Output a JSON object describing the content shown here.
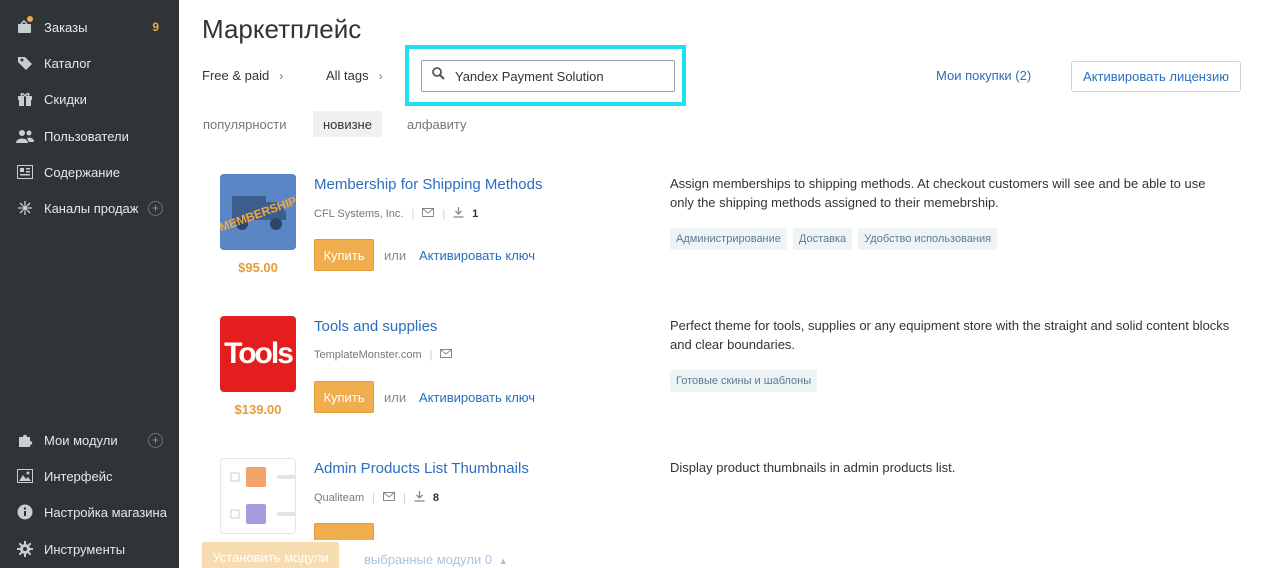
{
  "sidebar": {
    "items": [
      {
        "label": "Заказы",
        "badge": "9",
        "icon": "orders-icon"
      },
      {
        "label": "Каталог",
        "icon": "tag-icon"
      },
      {
        "label": "Скидки",
        "icon": "gift-icon"
      },
      {
        "label": "Пользователи",
        "icon": "users-icon"
      },
      {
        "label": "Содержание",
        "icon": "content-icon"
      },
      {
        "label": "Каналы продаж",
        "icon": "channels-icon"
      },
      {
        "label": "Мои модули",
        "icon": "puzzle-icon"
      },
      {
        "label": "Интерфейс",
        "icon": "image-icon"
      },
      {
        "label": "Настройка магазина",
        "icon": "info-icon"
      },
      {
        "label": "Инструменты",
        "icon": "gear-icon"
      }
    ]
  },
  "header": {
    "title": "Маркетплейс",
    "breadcrumbs": [
      "Free & paid",
      "All tags"
    ],
    "search_value": "Yandex Payment Solution",
    "purchases": "Мои покупки (2)",
    "activate_license": "Активировать лицензию"
  },
  "sort": {
    "tabs": [
      "популярности",
      "новизне",
      "алфавиту"
    ],
    "active": "новизне"
  },
  "products": [
    {
      "title": "Membership for Shipping Methods",
      "vendor": "CFL Systems, Inc.",
      "downloads": "1",
      "price": "$95.00",
      "buy": "Купить",
      "or": "или",
      "activate": "Активировать ключ",
      "thumb_text": "MEMBERSHIP",
      "description": "Assign memberships to shipping methods. At checkout customers will see and be able to use only the shipping methods assigned to their memebrship.",
      "tags": [
        "Администрирование",
        "Доставка",
        "Удобство использования"
      ]
    },
    {
      "title": "Tools and supplies",
      "vendor": "TemplateMonster.com",
      "price": "$139.00",
      "buy": "Купить",
      "or": "или",
      "activate": "Активировать ключ",
      "thumb_text": "Tools",
      "description": "Perfect theme for tools, supplies or any equipment store with the straight and solid content blocks and clear boundaries.",
      "tags": [
        "Готовые скины и шаблоны"
      ]
    },
    {
      "title": "Admin Products List Thumbnails",
      "vendor": "Qualiteam",
      "downloads": "8",
      "description": "Display product thumbnails in admin products list."
    }
  ],
  "footer": {
    "install": "Установить модули",
    "selected": "выбранные модули 0"
  },
  "colors": {
    "sidebar_bg": "#2f3437",
    "accent_orange": "#f0ad4e",
    "link_blue": "#2a6ebf",
    "highlight_cyan": "#20e0ee"
  }
}
